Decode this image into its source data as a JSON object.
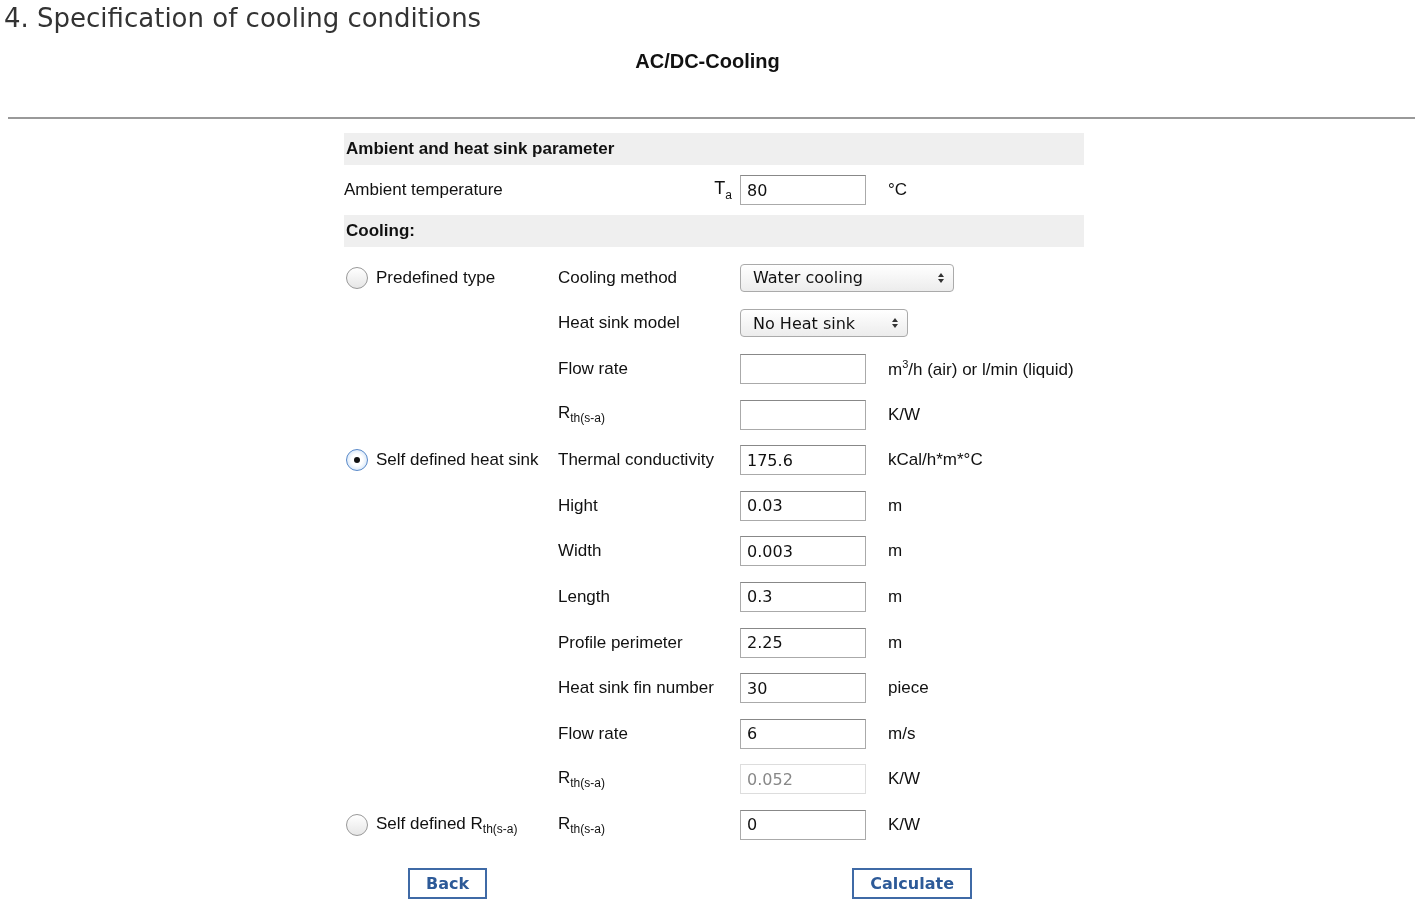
{
  "page_heading": "4. Specification of cooling conditions",
  "title": "AC/DC-Cooling",
  "ambient": {
    "section": "Ambient and heat sink parameter",
    "label": "Ambient temperature",
    "symbol": "T$_{a}$",
    "value": "80",
    "unit": "°C"
  },
  "cooling": {
    "section": "Cooling:",
    "options": [
      {
        "label": "Predefined type",
        "selected": false,
        "rows": [
          {
            "kind": "select",
            "label": "Cooling method",
            "value": "Water cooling",
            "wide": true
          },
          {
            "kind": "select",
            "label": "Heat sink model",
            "value": "No Heat sink",
            "wide": false
          },
          {
            "kind": "input",
            "label": "Flow rate",
            "unit": "m$^{3}$/h (air) or l/min (liquid)",
            "disabled": false
          },
          {
            "kind": "input",
            "label": "R$_{th(s-a)}$",
            "unit": "K/W",
            "disabled": false
          }
        ]
      },
      {
        "label": "Self defined heat sink",
        "selected": true,
        "rows": [
          {
            "kind": "input",
            "label": "Thermal conductivity",
            "value": "175.6",
            "unit": "kCal/h*m*°C",
            "disabled": false
          },
          {
            "kind": "input",
            "label": "Hight",
            "value": "0.03",
            "unit": "m",
            "disabled": false
          },
          {
            "kind": "input",
            "label": "Width",
            "value": "0.003",
            "unit": "m",
            "disabled": false
          },
          {
            "kind": "input",
            "label": "Length",
            "value": "0.3",
            "unit": "m",
            "disabled": false
          },
          {
            "kind": "input",
            "label": "Profile perimeter",
            "value": "2.25",
            "unit": "m",
            "disabled": false
          },
          {
            "kind": "input",
            "label": "Heat sink fin number",
            "value": "30",
            "unit": "piece",
            "disabled": false
          },
          {
            "kind": "input",
            "label": "Flow rate",
            "value": "6",
            "unit": "m/s",
            "disabled": false
          },
          {
            "kind": "input",
            "label": "R$_{th(s-a)}$",
            "value": "0.052",
            "unit": "K/W",
            "disabled": true
          }
        ]
      },
      {
        "label": "Self defined R$_{th(s-a)}$",
        "selected": false,
        "rows": [
          {
            "kind": "input",
            "label": "R$_{th(s-a)}$",
            "value": "0",
            "unit": "K/W",
            "disabled": false
          }
        ]
      }
    ]
  },
  "buttons": [
    "Back",
    "Calculate"
  ]
}
